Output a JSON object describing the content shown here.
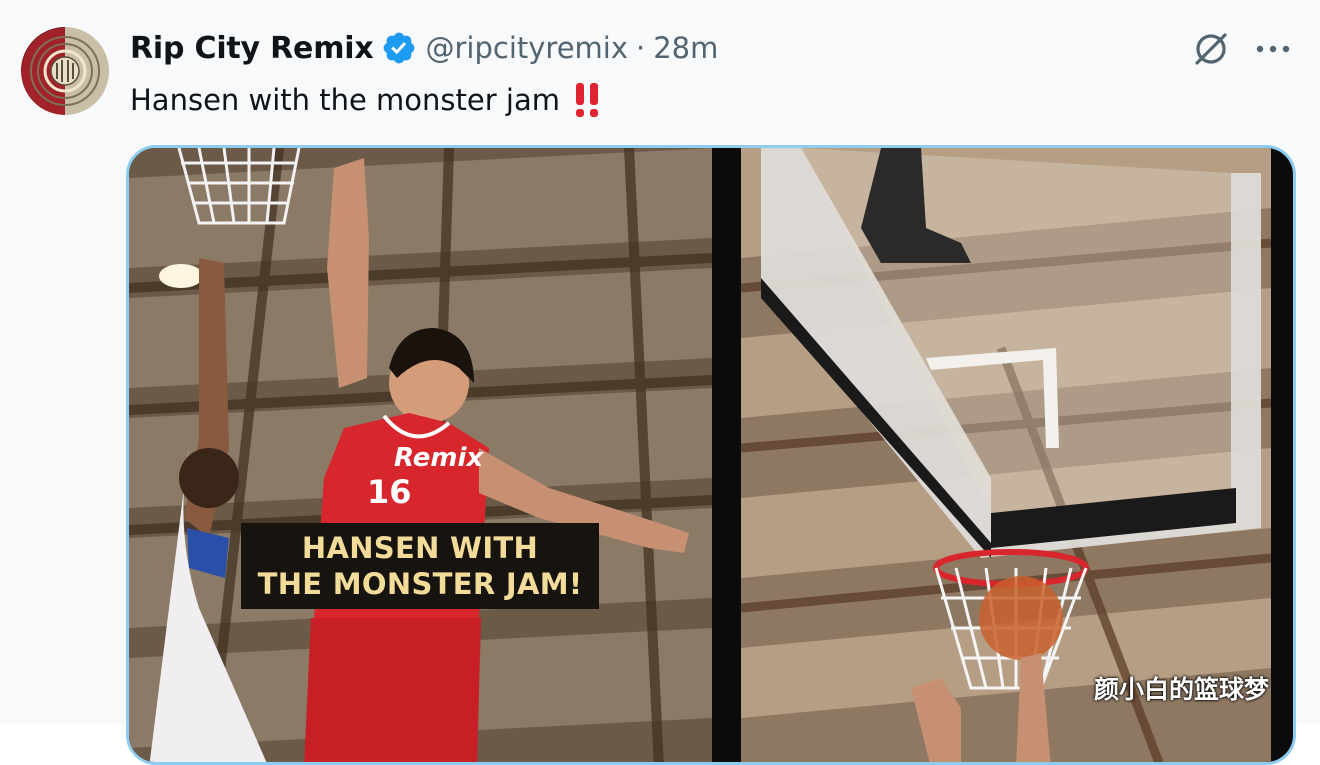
{
  "tweet": {
    "author_name": "Rip City Remix",
    "handle": "@ripcityremix",
    "separator": "·",
    "time": "28m",
    "text": "Hansen with the monster jam",
    "emoji": "‼️"
  },
  "icons": {
    "avatar": "rip-city-remix-logo",
    "verified": "verified-badge-icon",
    "grok": "grok-icon",
    "more": "more-dots-icon"
  },
  "media": {
    "caption_line1": "HANSEN WITH",
    "caption_line2": "THE MONSTER JAM!",
    "jersey_text": "Remix",
    "jersey_number": "16"
  },
  "watermark": "颜小白的篮球梦",
  "colors": {
    "verified_blue": "#1d9bf0",
    "media_border": "#8ecdf0",
    "caption_text": "#f3dc9a",
    "jersey_red": "#d8262d",
    "emoji_red": "#e02331"
  }
}
